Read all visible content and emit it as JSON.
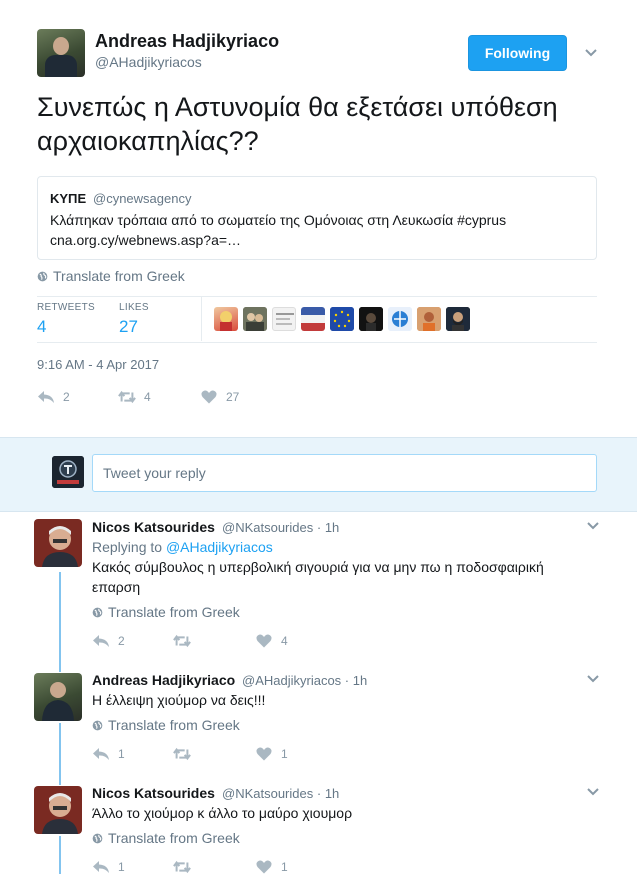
{
  "tweet": {
    "author_name": "Andreas Hadjikyriaco",
    "author_handle": "@AHadjikyriacos",
    "follow_label": "Following",
    "text": "Συνεπώς η Αστυνομία θα εξετάσει υπόθεση αρχαιοκαπηλίας??",
    "quote": {
      "name": "ΚΥΠΕ",
      "handle": "@cynewsagency",
      "text": "Κλάπηκαν τρόπαια από το σωματείο της Ομόνοιας στη Λευκωσία #cyprus cna.org.cy/webnews.asp?a=…"
    },
    "translate_label": "Translate from Greek",
    "retweets_label": "RETWEETS",
    "retweets_count": "4",
    "likes_label": "LIKES",
    "likes_count": "27",
    "timestamp": "9:16 AM - 4 Apr 2017",
    "actions": {
      "reply": "2",
      "retweet": "4",
      "like": "27"
    }
  },
  "liker_avatars": [
    {
      "icon": "avatar-woman-blonde"
    },
    {
      "icon": "avatar-group-photo"
    },
    {
      "icon": "avatar-text-card"
    },
    {
      "icon": "avatar-flag-stripes"
    },
    {
      "icon": "avatar-eu-flag"
    },
    {
      "icon": "avatar-dark-portrait"
    },
    {
      "icon": "avatar-globe-logo"
    },
    {
      "icon": "avatar-man-orange"
    },
    {
      "icon": "avatar-bearded-man"
    }
  ],
  "reply_box": {
    "placeholder": "Tweet your reply"
  },
  "replies": [
    {
      "name": "Nicos Katsourides",
      "handle": "@NKatsourides",
      "time": "1h",
      "replying_prefix": "Replying to",
      "replying_to": "@AHadjikyriacos",
      "text": "Κακός σύμβουλος η υπερβολική σιγουριά για να μην πω η ποδοσφαιρική επαρση",
      "translate": "Translate from Greek",
      "reply_count": "2",
      "retweet_count": "",
      "like_count": "4"
    },
    {
      "name": "Andreas Hadjikyriaco",
      "handle": "@AHadjikyriacos",
      "time": "1h",
      "text": "Η έλλειψη χιούμορ να δεις!!!",
      "translate": "Translate from Greek",
      "reply_count": "1",
      "retweet_count": "",
      "like_count": "1"
    },
    {
      "name": "Nicos Katsourides",
      "handle": "@NKatsourides",
      "time": "1h",
      "text": "Άλλο το χιούμορ κ άλλο το μαύρο χιουμορ",
      "translate": "Translate from Greek",
      "reply_count": "1",
      "retweet_count": "",
      "like_count": "1"
    }
  ],
  "colors": {
    "accent": "#1da1f2",
    "muted": "#657786",
    "thread": "#83c4ef"
  },
  "separator": " · "
}
